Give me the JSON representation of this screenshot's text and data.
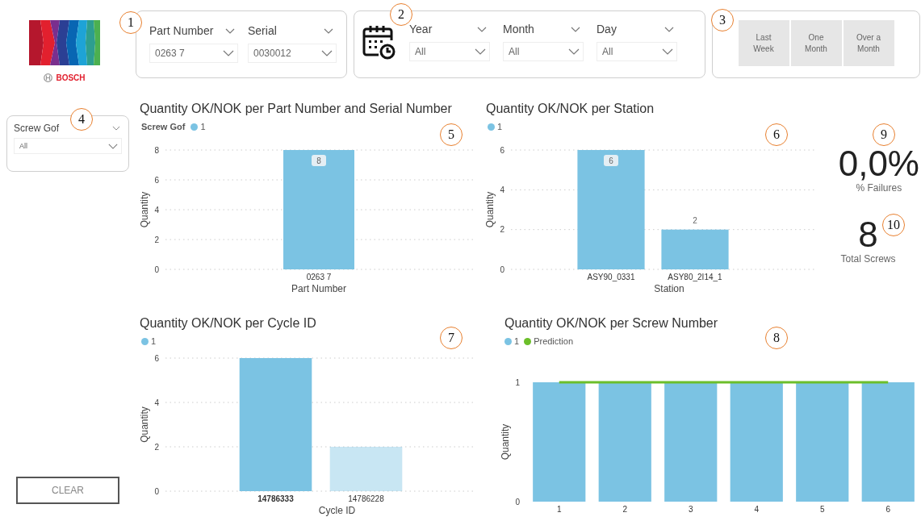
{
  "logo": {
    "brand": "BOSCH"
  },
  "part_filter": {
    "callout": "1",
    "slicers": [
      {
        "label": "Part Number",
        "value": "0263 7"
      },
      {
        "label": "Serial",
        "value": "0030012"
      }
    ]
  },
  "date_filter": {
    "callout": "2",
    "slicers": [
      {
        "label": "Year",
        "value": "All"
      },
      {
        "label": "Month",
        "value": "All"
      },
      {
        "label": "Day",
        "value": "All"
      }
    ]
  },
  "period_filter": {
    "callout": "3",
    "buttons": [
      "Last Week",
      "One Month",
      "Over a Month"
    ]
  },
  "side_filter": {
    "callout": "4",
    "label": "Screw Gof",
    "value": "All"
  },
  "clear_button": "CLEAR",
  "charts": [
    {
      "title": "Quantity OK/NOK per Part Number and Serial Number",
      "callout": "5",
      "legend_title": "Screw Gof",
      "chart_data": {
        "type": "bar",
        "xlabel": "Part Number",
        "ylabel": "Quantity",
        "categories": [
          "0263 7"
        ],
        "series": [
          {
            "name": "1",
            "color": "#7bc3e3",
            "type": "bar",
            "values": [
              8
            ]
          }
        ],
        "ylim": [
          0,
          8
        ],
        "yticks": [
          0,
          2,
          4,
          6,
          8
        ],
        "grid": true,
        "data_labels": true
      }
    },
    {
      "title": "Quantity OK/NOK per Station",
      "callout": "6",
      "chart_data": {
        "type": "bar",
        "xlabel": "Station",
        "ylabel": "Quantity",
        "categories": [
          "ASY90_0331",
          "ASY80_2I14_1"
        ],
        "series": [
          {
            "name": "1",
            "color": "#7bc3e3",
            "type": "bar",
            "values": [
              6,
              2
            ]
          }
        ],
        "ylim": [
          0,
          6
        ],
        "yticks": [
          0,
          2,
          4,
          6
        ],
        "grid": true,
        "data_labels": true
      }
    },
    {
      "title": "Quantity OK/NOK per Cycle ID",
      "callout": "7",
      "bar_selected": [
        true,
        false
      ],
      "chart_data": {
        "type": "bar",
        "xlabel": "Cycle ID",
        "ylabel": "Quantity",
        "categories": [
          "14786333",
          "14786228"
        ],
        "series": [
          {
            "name": "1",
            "color": "#7bc3e3",
            "type": "bar",
            "values": [
              6,
              2
            ]
          }
        ],
        "ylim": [
          0,
          6
        ],
        "yticks": [
          0,
          2,
          4,
          6
        ],
        "grid": true
      }
    },
    {
      "title": "Quantity OK/NOK per Screw Number",
      "callout": "8",
      "chart_data": {
        "type": "bar",
        "ylabel": "Quantity",
        "categories": [
          "1",
          "2",
          "3",
          "4",
          "5",
          "6"
        ],
        "series": [
          {
            "name": "1",
            "color": "#7bc3e3",
            "type": "bar",
            "values": [
              1,
              1,
              1,
              1,
              1,
              1
            ]
          },
          {
            "name": "Prediction",
            "color": "#6cbf2a",
            "type": "line",
            "values": [
              1,
              1,
              1,
              1,
              1,
              1
            ]
          }
        ],
        "ylim": [
          0,
          1
        ],
        "yticks": [
          0,
          1
        ],
        "stacked": false
      }
    }
  ],
  "kpis": [
    {
      "callout": "9",
      "value": "0,0%",
      "label": "% Failures"
    },
    {
      "callout": "10",
      "value": "8",
      "label": "Total Screws"
    }
  ]
}
